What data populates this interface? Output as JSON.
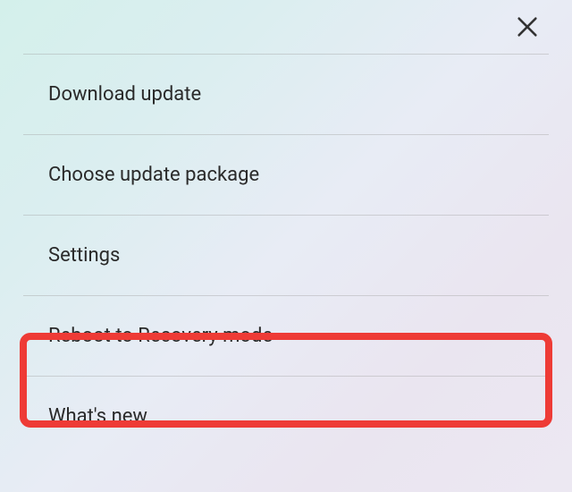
{
  "close_label": "Close",
  "menu": {
    "items": [
      {
        "label": "Download update"
      },
      {
        "label": "Choose update package"
      },
      {
        "label": "Settings"
      },
      {
        "label": "Reboot to Recovery mode"
      },
      {
        "label": "What's new"
      }
    ]
  },
  "highlight": {
    "color": "#ee3b36",
    "target_index": 3
  }
}
